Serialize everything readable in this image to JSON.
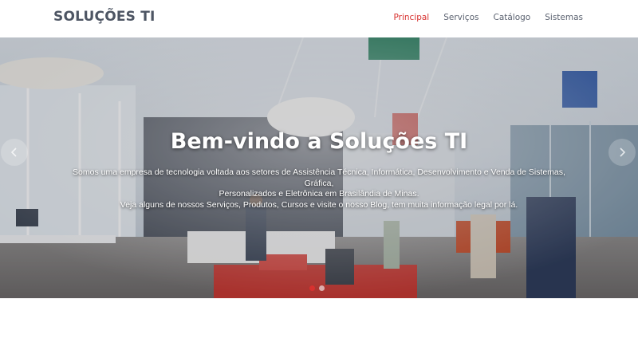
{
  "header": {
    "brand": "SOLUÇÕES TI",
    "nav": [
      {
        "label": "Principal",
        "active": true
      },
      {
        "label": "Serviços",
        "active": false
      },
      {
        "label": "Catálogo",
        "active": false
      },
      {
        "label": "Sistemas",
        "active": false
      }
    ]
  },
  "hero": {
    "title": "Bem-vindo a Soluções TI",
    "text_lines": [
      "Somos uma empresa de tecnologia voltada aos setores de Assistência Técnica, Informática, Desenvolvimento e Venda de Sistemas, Gráfica,",
      "Personalizados e Eletrônica em Brasilândia de Minas.",
      "Veja alguns de nossos Serviços, Produtos, Cursos e visite o nosso Blog, tem muita informação legal por lá."
    ],
    "prev_icon": "chevron-left-icon",
    "next_icon": "chevron-right-icon",
    "slides": 2,
    "active_slide": 1
  },
  "colors": {
    "accent": "#d8312f",
    "brand_text": "#4d5563",
    "nav_text": "#5b6270"
  }
}
